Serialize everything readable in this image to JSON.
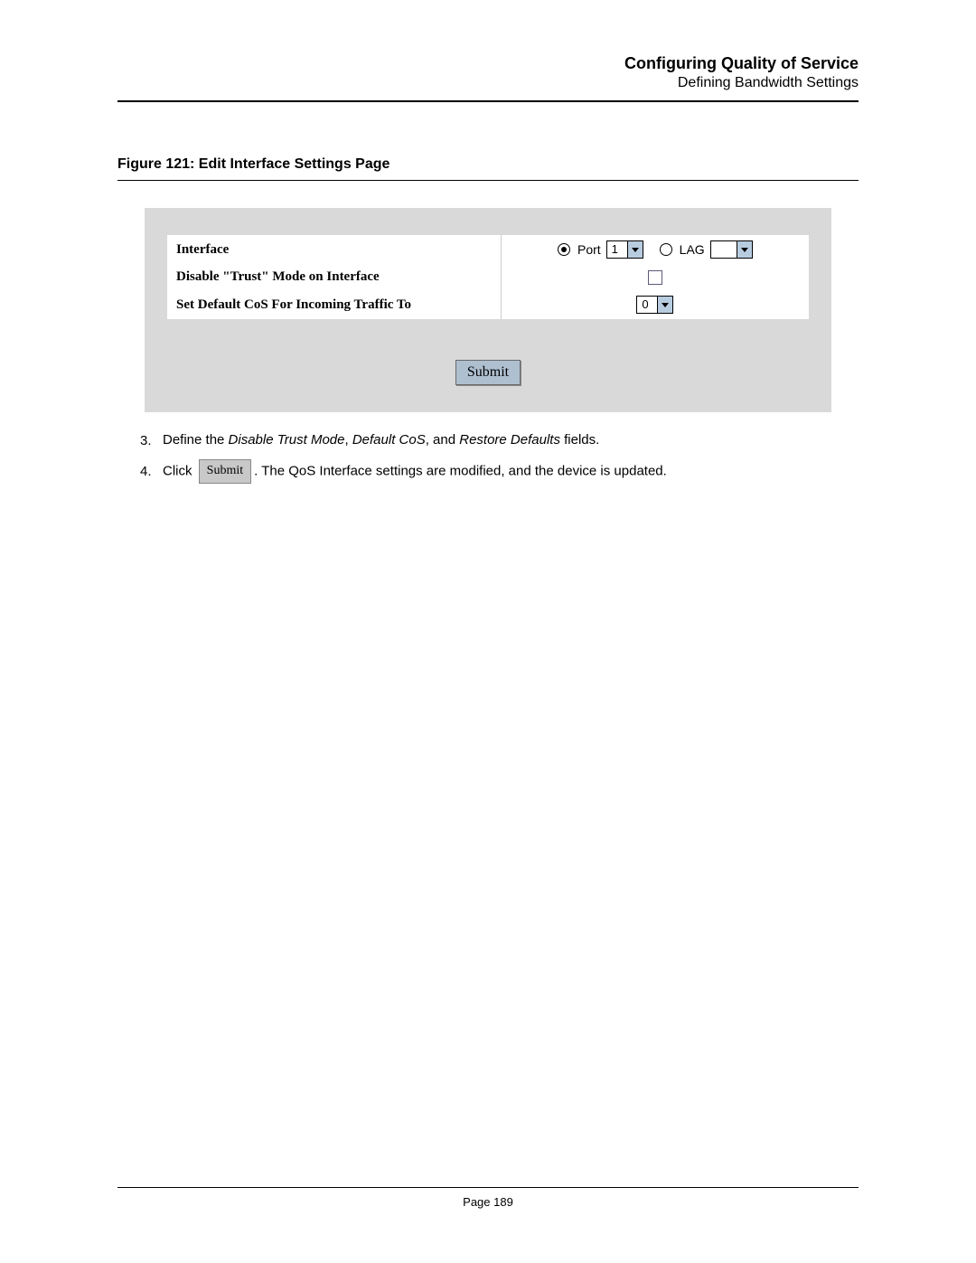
{
  "header": {
    "title": "Configuring Quality of Service",
    "subtitle": "Defining Bandwidth Settings"
  },
  "figure": {
    "caption": "Figure 121: Edit Interface Settings Page"
  },
  "panel": {
    "row_interface_label": "Interface",
    "port_label": "Port",
    "port_value": "1",
    "lag_label": "LAG",
    "lag_value": "",
    "row_disable_label": "Disable \"Trust\" Mode on Interface",
    "row_cos_label": "Set Default CoS For Incoming Traffic To",
    "cos_value": "0",
    "submit_label": "Submit"
  },
  "steps": {
    "s3_num": "3.",
    "s3_pre": "Define the ",
    "s3_i1": "Disable Trust Mode",
    "s3_mid1": ", ",
    "s3_i2": "Default CoS",
    "s3_mid2": ", and ",
    "s3_i3": "Restore Defaults",
    "s3_post": " fields.",
    "s4_num": "4.",
    "s4_pre": "Click ",
    "s4_btn": "Submit",
    "s4_post": ". The QoS Interface settings are modified, and the device is updated."
  },
  "footer": {
    "page": "Page 189"
  }
}
